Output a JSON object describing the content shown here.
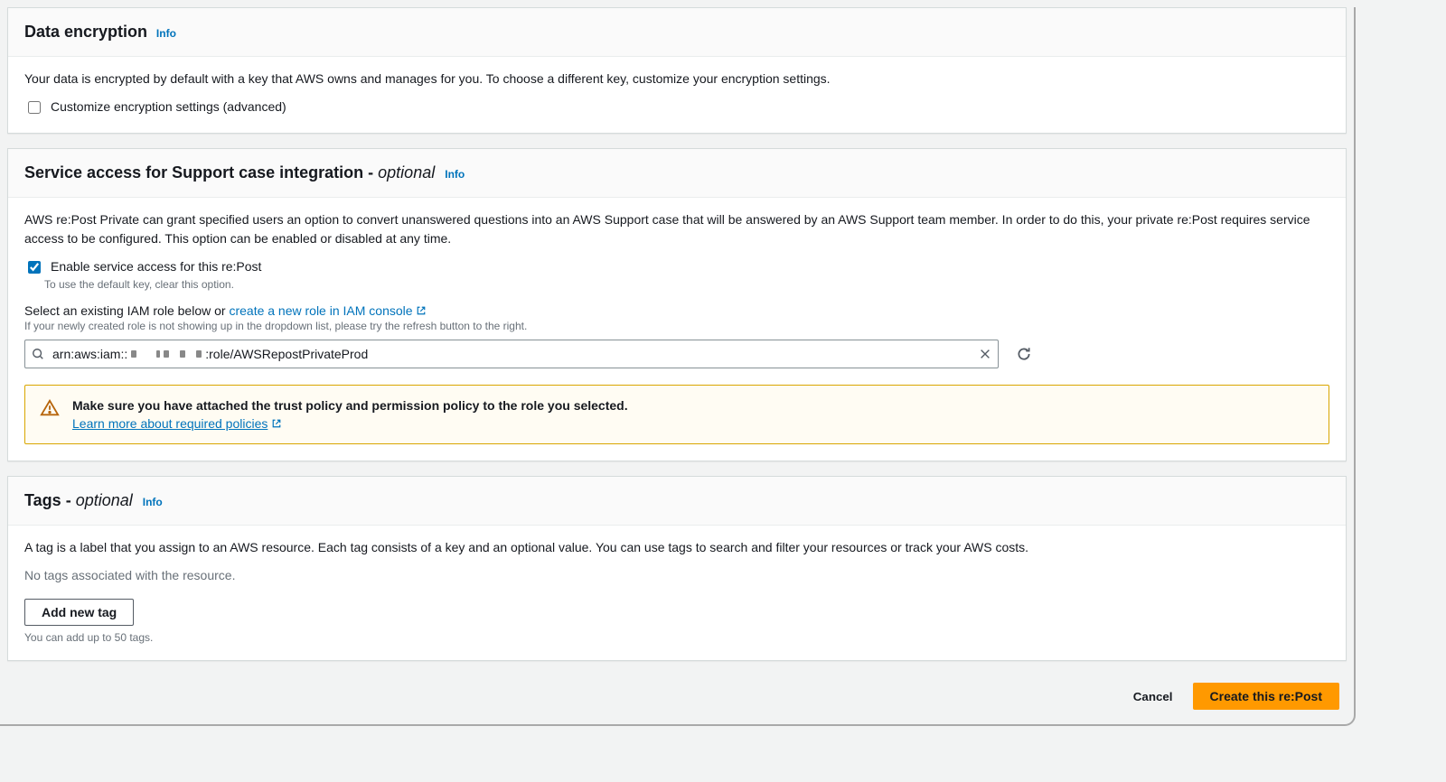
{
  "encryption": {
    "title": "Data encryption",
    "info": "Info",
    "desc": "Your data is encrypted by default with a key that AWS owns and manages for you. To choose a different key, customize your encryption settings.",
    "customize_label": "Customize encryption settings (advanced)"
  },
  "service_access": {
    "title": "Service access for Support case integration",
    "optional": "optional",
    "info": "Info",
    "desc": "AWS re:Post Private can grant specified users an option to convert unanswered questions into an AWS Support case that will be answered by an AWS Support team member. In order to do this, your private re:Post requires service access to be configured. This option can be enabled or disabled at any time.",
    "enable_label": "Enable service access for this re:Post",
    "enable_hint": "To use the default key, clear this option.",
    "select_label_prefix": "Select an existing IAM role below or ",
    "create_role_link": "create a new role in IAM console",
    "select_hint": "If your newly created role is not showing up in the dropdown list, please try the refresh button to the right.",
    "role_value_prefix": "arn:aws:iam::",
    "role_value_suffix": ":role/AWSRepostPrivateProd",
    "alert_title": "Make sure you have attached the trust policy and permission policy to the role you selected.",
    "alert_link": "Learn more about required policies"
  },
  "tags": {
    "title": "Tags",
    "optional": "optional",
    "info": "Info",
    "desc": "A tag is a label that you assign to an AWS resource. Each tag consists of a key and an optional value. You can use tags to search and filter your resources or track your AWS costs.",
    "empty": "No tags associated with the resource.",
    "add_button": "Add new tag",
    "limit": "You can add up to 50 tags."
  },
  "footer": {
    "cancel": "Cancel",
    "create": "Create this re:Post"
  }
}
